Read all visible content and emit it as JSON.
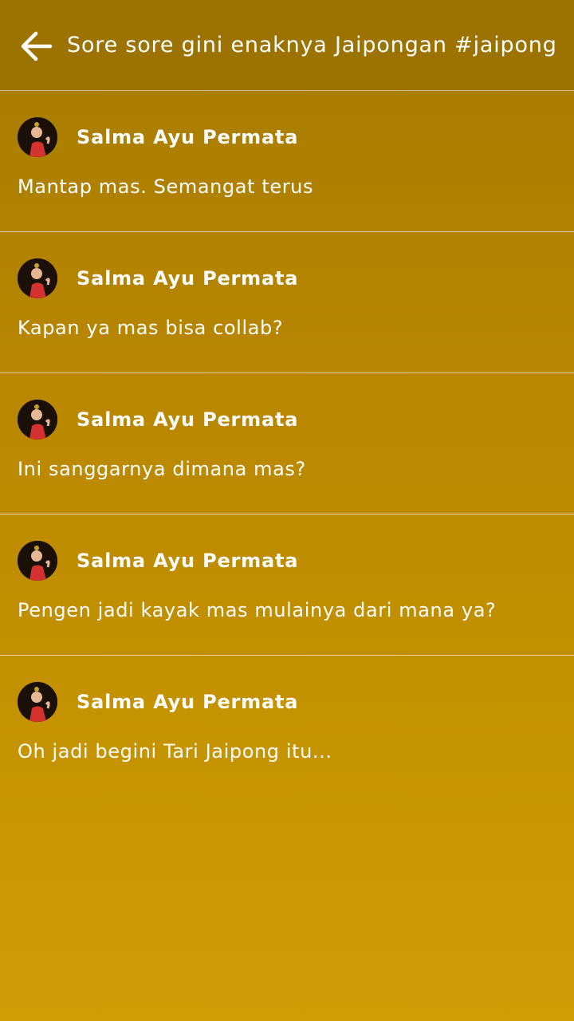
{
  "header": {
    "back_icon": "arrow-left-icon",
    "title": "Sore sore gini enaknya Jaipongan #jaipong"
  },
  "comments": [
    {
      "author": "Salma Ayu Permata",
      "text": "Mantap mas. Semangat terus"
    },
    {
      "author": "Salma Ayu Permata",
      "text": "Kapan ya mas bisa collab?"
    },
    {
      "author": "Salma Ayu Permata",
      "text": "Ini sanggarnya dimana mas?"
    },
    {
      "author": "Salma Ayu Permata",
      "text": "Pengen jadi kayak mas mulainya dari mana ya?"
    },
    {
      "author": "Salma Ayu Permata",
      "text": "Oh jadi begini Tari Jaipong itu..."
    }
  ],
  "colors": {
    "header_bg": "#9c7300",
    "gradient_top": "#a67b00",
    "gradient_bottom": "#d19c06",
    "text": "#ffffff"
  }
}
